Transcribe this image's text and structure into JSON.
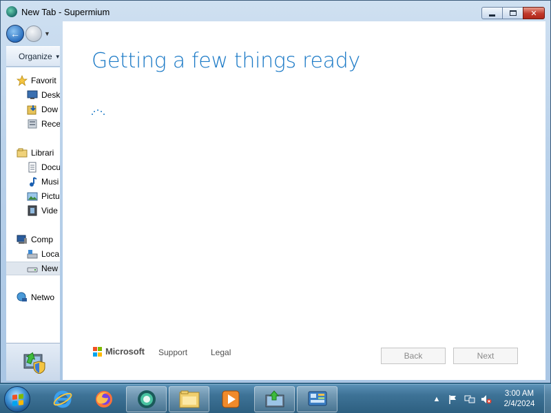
{
  "window": {
    "title": "New Tab - Supermium",
    "controls": {
      "minimize": "minimize",
      "maximize": "maximize",
      "close": "✕"
    }
  },
  "explorer": {
    "organize_label": "Organize",
    "sidebar": [
      {
        "label": "Favorit",
        "icon": "star-icon"
      },
      {
        "label": "Desk",
        "icon": "desktop-icon"
      },
      {
        "label": "Dow",
        "icon": "downloads-icon"
      },
      {
        "label": "Rece",
        "icon": "recent-places-icon"
      },
      {
        "label": "Librari",
        "icon": "libraries-icon"
      },
      {
        "label": "Docu",
        "icon": "documents-icon"
      },
      {
        "label": "Musi",
        "icon": "music-icon"
      },
      {
        "label": "Pictu",
        "icon": "pictures-icon"
      },
      {
        "label": "Vide",
        "icon": "videos-icon"
      },
      {
        "label": "Comp",
        "icon": "computer-icon"
      },
      {
        "label": "Loca",
        "icon": "local-disk-icon"
      },
      {
        "label": "New",
        "icon": "drive-icon",
        "selected": true
      },
      {
        "label": "Netwo",
        "icon": "network-icon"
      }
    ]
  },
  "setup": {
    "heading": "Getting a few things ready",
    "brand": "Microsoft",
    "support_link": "Support",
    "legal_link": "Legal",
    "back_button": "Back",
    "next_button": "Next",
    "accent_color": "#1a79c6"
  },
  "taskbar": {
    "items": [
      "start-orb",
      "internet-explorer-icon",
      "firefox-icon",
      "supermium-icon",
      "file-explorer-icon",
      "media-player-icon",
      "windows-setup-icon",
      "control-panel-icon"
    ],
    "clock_time": "3:00 AM",
    "clock_date": "2/4/2024"
  }
}
